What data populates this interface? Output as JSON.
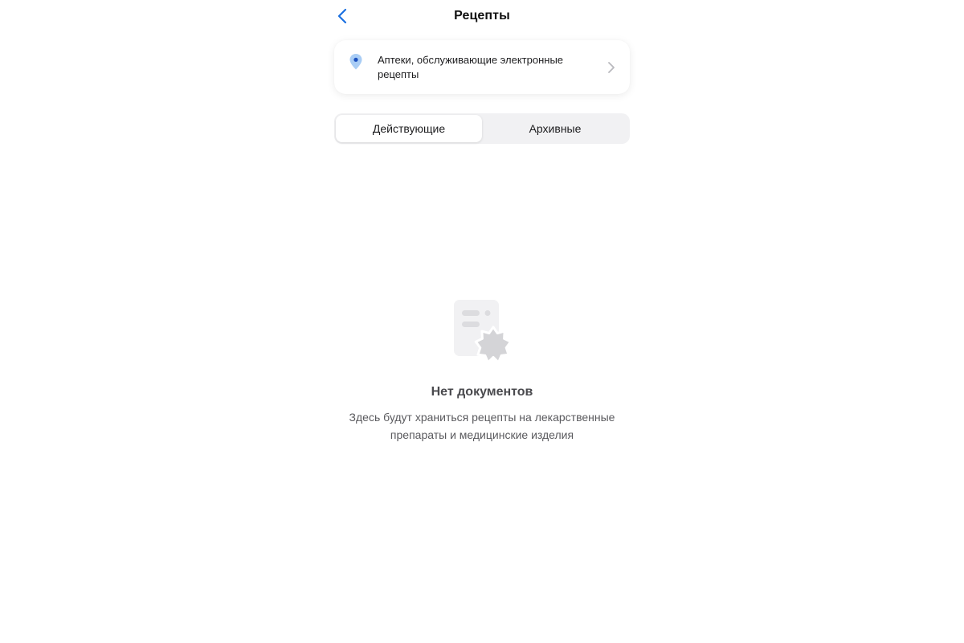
{
  "header": {
    "title": "Рецепты",
    "back_icon": "chevron-left-icon",
    "accent_color": "#1a6fe0"
  },
  "pharmacy_card": {
    "icon": "location-pin-icon",
    "text": "Аптеки, обслуживающие электронные рецепты",
    "chevron_icon": "chevron-right-icon"
  },
  "tabs": {
    "items": [
      {
        "label": "Действующие",
        "selected": true
      },
      {
        "label": "Архивные",
        "selected": false
      }
    ]
  },
  "empty_state": {
    "icon": "document-badge-icon",
    "title": "Нет документов",
    "description": "Здесь будут храниться рецепты на лекарственные препараты и медицинские изделия"
  }
}
